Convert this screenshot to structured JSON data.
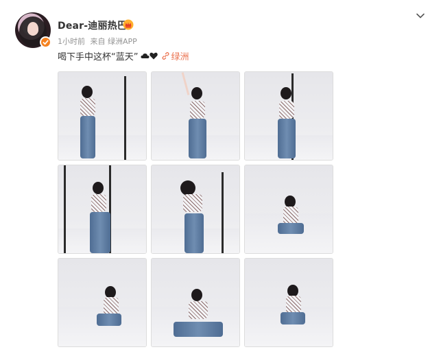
{
  "post": {
    "username": "Dear-迪丽热巴",
    "time": "1小时前",
    "source": "来自 绿洲APP",
    "text": "喝下手中这杯“蓝天”",
    "emoji_icons": [
      "cloud-icon",
      "heart-icon"
    ],
    "link": "绿洲",
    "photos": [
      {
        "pose": "standing-cup"
      },
      {
        "pose": "arm-raised"
      },
      {
        "pose": "leaning-cup"
      },
      {
        "pose": "standing-wall"
      },
      {
        "pose": "hair-flip"
      },
      {
        "pose": "sitting"
      },
      {
        "pose": "sitting-drink"
      },
      {
        "pose": "sitting-front"
      },
      {
        "pose": "sitting-hand"
      }
    ]
  },
  "colors": {
    "link": "#eb7350",
    "meta": "#939393",
    "verified": "#f58220"
  }
}
